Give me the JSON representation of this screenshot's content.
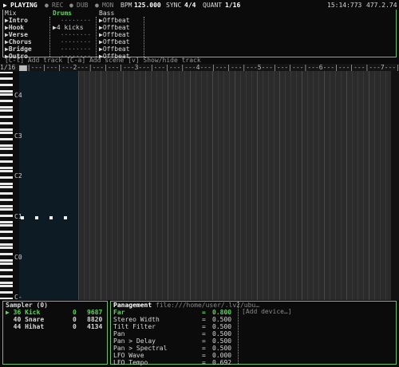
{
  "transport": {
    "play_icon": "play-icon",
    "playing": "PLAYING",
    "rec": "REC",
    "dub": "DUB",
    "mon": "MON",
    "bpm_label": "BPM",
    "bpm_value": "125.000",
    "sync_label": "SYNC",
    "sync_value": "4/4",
    "quant_label": "QUANT",
    "quant_value": "1/16",
    "time": "15:14:773",
    "position": "477.2.74"
  },
  "session": {
    "columns": [
      "Mix",
      "Drums",
      "Bass"
    ],
    "scenes": [
      "Intro",
      "Hook",
      "Verse",
      "Chorus",
      "Bridge",
      "Outro"
    ],
    "drums": [
      "········",
      "4 kicks",
      "········",
      "········",
      "········",
      "········"
    ],
    "bass": [
      "Offbeat",
      "Offbeat",
      "Offbeat",
      "Offbeat",
      "Offbeat",
      "Offbeat"
    ]
  },
  "help": {
    "add_track": "[C-t] Add track",
    "add_scene": "[C-a] Add scene",
    "show_hide": "[v] Show/hide track"
  },
  "roll": {
    "ruler": "1/16 ▆▆|---|---|---2---|---|---|---3---|---|---|---4---|---|---|---5---|---|---|---6---|---|---|---7---|---|",
    "octaves": [
      "C4",
      "C3",
      "C2",
      "C1",
      "C0",
      "C-"
    ]
  },
  "sampler": {
    "title": "Sampler (0)",
    "rows": [
      {
        "marker": "▶",
        "num": "36",
        "name": "Kick",
        "val": "0",
        "size": "9687"
      },
      {
        "marker": "",
        "num": "40",
        "name": "Snare",
        "val": "0",
        "size": "8820"
      },
      {
        "marker": "",
        "num": "44",
        "name": "Hihat",
        "val": "0",
        "size": "4134"
      }
    ]
  },
  "device": {
    "title": "Panagement",
    "path": "file:///home/user/.lv2/ubu…",
    "add_device": "[Add device…]",
    "params": [
      {
        "name": "Far",
        "eq": "=",
        "value": "0.800"
      },
      {
        "name": "Stereo Width",
        "eq": "=",
        "value": "0.500"
      },
      {
        "name": "Tilt Filter",
        "eq": "=",
        "value": "0.500"
      },
      {
        "name": "Pan",
        "eq": "=",
        "value": "0.500"
      },
      {
        "name": "Pan > Delay",
        "eq": "=",
        "value": "0.500"
      },
      {
        "name": "Pan > Spectral",
        "eq": "=",
        "value": "0.500"
      },
      {
        "name": "LFO Wave",
        "eq": "=",
        "value": "0.000"
      },
      {
        "name": "LFO Tempo",
        "eq": "=",
        "value": "0.692"
      }
    ]
  },
  "colors": {
    "accent": "#5fd35f",
    "background": "#0b0b0b",
    "frame": "#6fbf6f"
  }
}
